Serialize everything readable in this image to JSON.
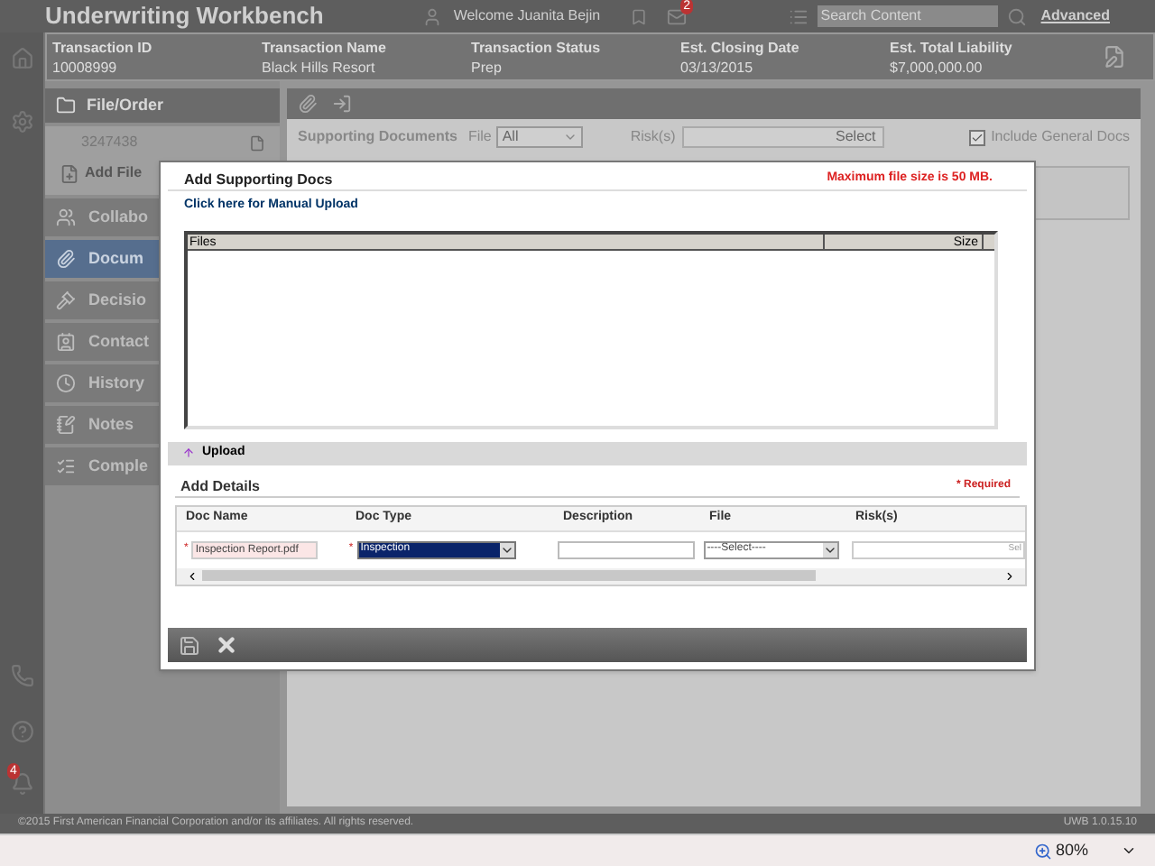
{
  "app": {
    "title": "Underwriting Workbench",
    "welcome": "Welcome Juanita Bejin",
    "mail_count": "2",
    "search_placeholder": "Search Content",
    "advanced": "Advanced"
  },
  "transaction": [
    {
      "label": "Transaction ID",
      "value": "10008999"
    },
    {
      "label": "Transaction Name",
      "value": "Black Hills Resort"
    },
    {
      "label": "Transaction Status",
      "value": "Prep"
    },
    {
      "label": "Est. Closing Date",
      "value": "03/13/2015"
    },
    {
      "label": "Est. Total Liability",
      "value": "$7,000,000.00"
    }
  ],
  "rail": {
    "notification_count": "4"
  },
  "sidebar": {
    "header": "File/Order",
    "file_number": "3247438",
    "add_file": "Add File",
    "items": [
      {
        "label": "Collabo",
        "kind": "people",
        "selected": false
      },
      {
        "label": "Docum",
        "kind": "clip",
        "selected": true
      },
      {
        "label": "Decisio",
        "kind": "gavel",
        "selected": false
      },
      {
        "label": "Contact",
        "kind": "card",
        "selected": false
      },
      {
        "label": "History",
        "kind": "clock",
        "selected": false
      },
      {
        "label": "Notes",
        "kind": "note",
        "selected": false
      },
      {
        "label": "Comple",
        "kind": "list",
        "selected": false
      }
    ]
  },
  "filters": {
    "title": "Supporting Documents",
    "file_label": "File",
    "file_value": "All",
    "risk_label": "Risk(s)",
    "risk_placeholder": "Select",
    "include_general": {
      "label": "Include General Docs",
      "checked": true
    }
  },
  "modal": {
    "title": "Add Supporting Docs",
    "max_note": "Maximum file size is 50 MB.",
    "manual_link": "Click here for Manual Upload",
    "files_columns": [
      "Files",
      "Size"
    ],
    "upload": "Upload",
    "details_title": "Add Details",
    "required": "* Required",
    "details_columns": [
      "Doc Name",
      "Doc Type",
      "Description",
      "File",
      "Risk(s)"
    ],
    "row": {
      "doc_name_marker": "*",
      "doc_type_marker": "*",
      "doc_name": "Inspection Report.pdf",
      "doc_type": "Inspection",
      "file": "----Select----",
      "risks": "Sel"
    }
  },
  "footer": {
    "copyright": "©2015 First American Financial Corporation and/or its affiliates. All rights reserved.",
    "version": "UWB 1.0.15.10"
  },
  "browser": {
    "zoom": "80%"
  }
}
